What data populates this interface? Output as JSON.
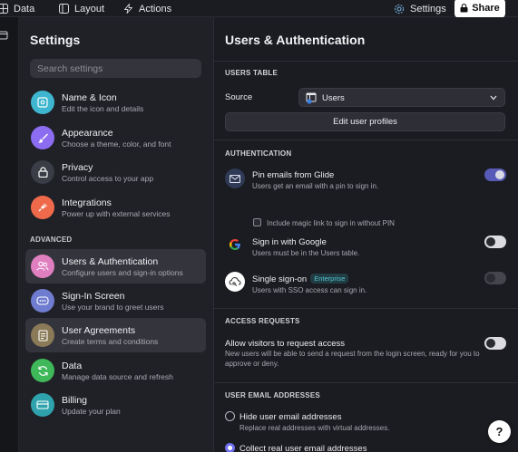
{
  "topbar": {
    "data_label": "Data",
    "layout_label": "Layout",
    "actions_label": "Actions",
    "settings_label": "Settings",
    "share_label": "Share"
  },
  "sidebar": {
    "title": "Settings",
    "search_placeholder": "Search settings",
    "advanced_label": "ADVANCED",
    "items": [
      {
        "label": "Name & Icon",
        "desc": "Edit the icon and details",
        "icon": "image-icon",
        "color": "#3fb6cf"
      },
      {
        "label": "Appearance",
        "desc": "Choose a theme, color, and font",
        "icon": "brush-icon",
        "color": "#8c6cf1"
      },
      {
        "label": "Privacy",
        "desc": "Control access to your app",
        "icon": "lock-icon",
        "color": "#3a3c46"
      },
      {
        "label": "Integrations",
        "desc": "Power up with external services",
        "icon": "plug-icon",
        "color": "#ef6a4a"
      },
      {
        "label": "Users & Authentication",
        "desc": "Configure users and sign-in options",
        "icon": "users-icon",
        "color": "#e07fc0"
      },
      {
        "label": "Sign-In Screen",
        "desc": "Use your brand to greet users",
        "icon": "login-icon",
        "color": "#6f7ccf"
      },
      {
        "label": "User Agreements",
        "desc": "Create terms and conditions",
        "icon": "document-icon",
        "color": "#8a7a57"
      },
      {
        "label": "Data",
        "desc": "Manage data source and refresh",
        "icon": "refresh-icon",
        "color": "#3fb85a"
      },
      {
        "label": "Billing",
        "desc": "Update your plan",
        "icon": "card-icon",
        "color": "#2fa3ad"
      }
    ]
  },
  "main": {
    "title": "Users & Authentication",
    "users_table": {
      "heading": "USERS TABLE",
      "source_label": "Source",
      "source_value": "Users",
      "edit_button": "Edit user profiles"
    },
    "authentication": {
      "heading": "AUTHENTICATION",
      "pin_label": "Pin emails from Glide",
      "pin_desc": "Users get an email with a pin to sign in.",
      "pin_enabled": true,
      "magic_link_label": "Include magic link to sign in without PIN",
      "magic_link_checked": false,
      "google_label": "Sign in with Google",
      "google_desc": "Users must be in the Users table.",
      "google_enabled": false,
      "sso_label": "Single sign-on",
      "sso_badge": "Enterprise",
      "sso_desc": "Users with SSO access can sign in.",
      "sso_enabled": false
    },
    "access_requests": {
      "heading": "ACCESS REQUESTS",
      "label": "Allow visitors to request access",
      "desc_line1": "New users will be able to send a request from the login screen, ready for you to",
      "desc_line2": "approve or deny.",
      "enabled": false
    },
    "user_emails": {
      "heading": "USER EMAIL ADDRESSES",
      "hide_label": "Hide user email addresses",
      "hide_desc": "Replace real addresses with virtual addresses.",
      "collect_label": "Collect real user email addresses",
      "selected": "collect"
    },
    "help_label": "?"
  },
  "colors": {
    "accent": "#575ab6",
    "enterprise_badge": "#52c4cf"
  }
}
